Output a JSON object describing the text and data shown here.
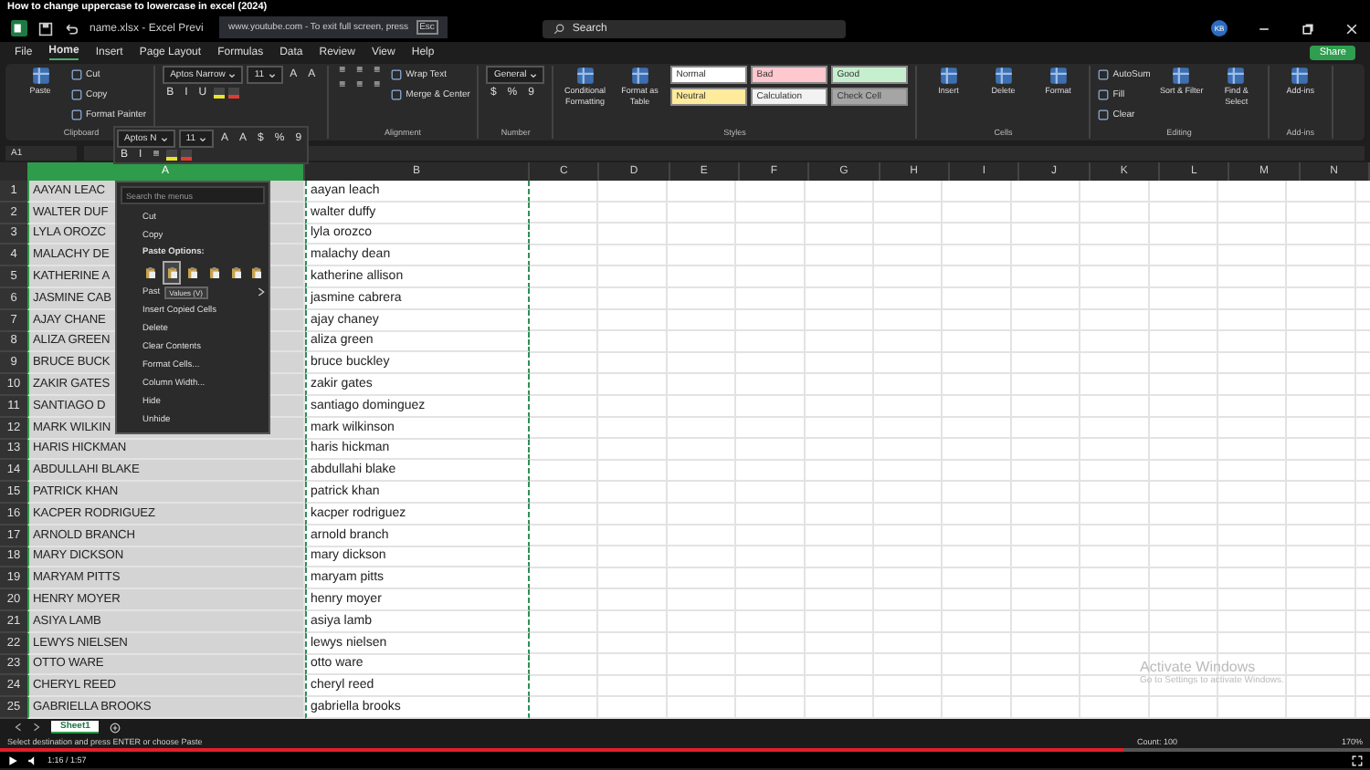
{
  "video_title": "How to change uppercase to lowercase in excel (2024)",
  "window": {
    "file": "name.xlsx - Excel Previ",
    "fullscreen_notice": "www.youtube.com - To exit full screen, press",
    "fullscreen_key": "Esc",
    "search_placeholder": "Search",
    "avatar": "KB"
  },
  "menu_tabs": [
    {
      "label": "File",
      "selected": false
    },
    {
      "label": "Home",
      "selected": true
    },
    {
      "label": "Insert",
      "selected": false
    },
    {
      "label": "Page Layout",
      "selected": false
    },
    {
      "label": "Formulas",
      "selected": false
    },
    {
      "label": "Data",
      "selected": false
    },
    {
      "label": "Review",
      "selected": false
    },
    {
      "label": "View",
      "selected": false
    },
    {
      "label": "Help",
      "selected": false
    }
  ],
  "share": "Share",
  "ribbon": [
    {
      "label": "Clipboard",
      "columns": [
        [
          [
            {
              "kind": "large",
              "label": "Paste"
            }
          ]
        ],
        [
          [
            {
              "kind": "small",
              "label": "Cut"
            }
          ],
          [
            {
              "kind": "small",
              "label": "Copy"
            }
          ],
          [
            {
              "kind": "small",
              "label": "Format Painter"
            }
          ]
        ]
      ]
    },
    {
      "columns": [
        [
          [
            {
              "kind": "field",
              "label": "Aptos Narrow"
            },
            {
              "kind": "field",
              "label": "11"
            },
            {
              "kind": "glyph",
              "label": "A"
            },
            {
              "kind": "glyph",
              "label": "A"
            }
          ],
          [
            {
              "kind": "glyph",
              "label": "B"
            },
            {
              "kind": "glyph",
              "label": "I"
            },
            {
              "kind": "glyph",
              "label": "U"
            },
            {
              "kind": "swatch",
              "color": "#e8e52a"
            },
            {
              "kind": "swatch",
              "color": "#e03c31"
            }
          ]
        ]
      ]
    },
    {
      "label": "Alignment",
      "columns": [
        [
          [
            {
              "kind": "glyph",
              "label": "≡"
            },
            {
              "kind": "glyph",
              "label": "≡"
            },
            {
              "kind": "glyph",
              "label": "≡"
            }
          ],
          [
            {
              "kind": "glyph",
              "label": "≡"
            },
            {
              "kind": "glyph",
              "label": "≡"
            },
            {
              "kind": "glyph",
              "label": "≡"
            }
          ]
        ],
        [
          [
            {
              "kind": "small",
              "label": "Wrap Text"
            }
          ],
          [
            {
              "kind": "small",
              "label": "Merge & Center"
            }
          ]
        ]
      ]
    },
    {
      "label": "Number",
      "columns": [
        [
          [
            {
              "kind": "field",
              "label": "General"
            }
          ],
          [
            {
              "kind": "glyph",
              "label": "$"
            },
            {
              "kind": "glyph",
              "label": "%"
            },
            {
              "kind": "glyph",
              "label": "9"
            }
          ]
        ]
      ]
    },
    {
      "label": "Styles",
      "columns": [
        [
          [
            {
              "kind": "large",
              "label": "Conditional Formatting"
            }
          ]
        ],
        [
          [
            {
              "kind": "large",
              "label": "Format as Table"
            }
          ]
        ],
        [
          [
            {
              "kind": "style",
              "label": "Normal",
              "color": "#ffffff"
            },
            {
              "kind": "style",
              "label": "Bad",
              "color": "#ffc7ce"
            },
            {
              "kind": "style",
              "label": "Good",
              "color": "#c6efce"
            }
          ],
          [
            {
              "kind": "style",
              "label": "Neutral",
              "color": "#ffeb9c"
            },
            {
              "kind": "style",
              "label": "Calculation",
              "color": "#f2f2f2"
            },
            {
              "kind": "style",
              "label": "Check Cell",
              "color": "#a5a5a5"
            }
          ]
        ]
      ]
    },
    {
      "label": "Cells",
      "columns": [
        [
          [
            {
              "kind": "large",
              "label": "Insert"
            }
          ]
        ],
        [
          [
            {
              "kind": "large",
              "label": "Delete"
            }
          ]
        ],
        [
          [
            {
              "kind": "large",
              "label": "Format"
            }
          ]
        ]
      ]
    },
    {
      "label": "Editing",
      "columns": [
        [
          [
            {
              "kind": "small",
              "label": "AutoSum"
            }
          ],
          [
            {
              "kind": "small",
              "label": "Fill"
            }
          ],
          [
            {
              "kind": "small",
              "label": "Clear"
            }
          ]
        ],
        [
          [
            {
              "kind": "large",
              "label": "Sort & Filter"
            }
          ]
        ],
        [
          [
            {
              "kind": "large",
              "label": "Find & Select"
            }
          ]
        ]
      ]
    },
    {
      "label": "Add-ins",
      "columns": [
        [
          [
            {
              "kind": "large",
              "label": "Add-ins"
            }
          ]
        ]
      ]
    }
  ],
  "name_box": "A1",
  "mini_toolbar": [
    [
      {
        "kind": "field",
        "label": "Aptos N"
      },
      {
        "kind": "field",
        "label": "11"
      },
      {
        "kind": "glyph",
        "label": "A"
      },
      {
        "kind": "glyph",
        "label": "A"
      },
      {
        "kind": "glyph",
        "label": "$"
      },
      {
        "kind": "glyph",
        "label": "%"
      },
      {
        "kind": "glyph",
        "label": "9"
      }
    ],
    [
      {
        "kind": "glyph",
        "label": "B"
      },
      {
        "kind": "glyph",
        "label": "I"
      },
      {
        "kind": "glyph",
        "label": "≡"
      },
      {
        "kind": "swatch",
        "color": "#e8e52a"
      },
      {
        "kind": "swatch",
        "color": "#e03c31"
      }
    ]
  ],
  "columns": [
    {
      "label": "A",
      "selected": true
    },
    {
      "label": "B",
      "selected": false
    },
    {
      "label": "C",
      "selected": false
    },
    {
      "label": "D",
      "selected": false
    },
    {
      "label": "E",
      "selected": false
    },
    {
      "label": "F",
      "selected": false
    },
    {
      "label": "G",
      "selected": false
    },
    {
      "label": "H",
      "selected": false
    },
    {
      "label": "I",
      "selected": false
    },
    {
      "label": "J",
      "selected": false
    },
    {
      "label": "K",
      "selected": false
    },
    {
      "label": "L",
      "selected": false
    },
    {
      "label": "M",
      "selected": false
    },
    {
      "label": "N",
      "selected": false
    }
  ],
  "rows": [
    {
      "number": "1",
      "cells": [
        "AAYAN LEAC",
        "aayan leach"
      ]
    },
    {
      "number": "2",
      "cells": [
        "WALTER DUF",
        "walter duffy"
      ]
    },
    {
      "number": "3",
      "cells": [
        "LYLA OROZC",
        "lyla orozco"
      ]
    },
    {
      "number": "4",
      "cells": [
        "MALACHY DE",
        "malachy dean"
      ]
    },
    {
      "number": "5",
      "cells": [
        "KATHERINE A",
        "katherine allison"
      ]
    },
    {
      "number": "6",
      "cells": [
        "JASMINE CAB",
        "jasmine cabrera"
      ]
    },
    {
      "number": "7",
      "cells": [
        "AJAY CHANE",
        "ajay chaney"
      ]
    },
    {
      "number": "8",
      "cells": [
        "ALIZA GREEN",
        "aliza green"
      ]
    },
    {
      "number": "9",
      "cells": [
        "BRUCE BUCK",
        "bruce buckley"
      ]
    },
    {
      "number": "10",
      "cells": [
        "ZAKIR GATES",
        "zakir gates"
      ]
    },
    {
      "number": "11",
      "cells": [
        "SANTIAGO D",
        "santiago dominguez"
      ]
    },
    {
      "number": "12",
      "cells": [
        "MARK WILKIN",
        "mark wilkinson"
      ]
    },
    {
      "number": "13",
      "cells": [
        "HARIS HICKMAN",
        "haris hickman"
      ]
    },
    {
      "number": "14",
      "cells": [
        "ABDULLAHI BLAKE",
        "abdullahi blake"
      ]
    },
    {
      "number": "15",
      "cells": [
        "PATRICK KHAN",
        "patrick khan"
      ]
    },
    {
      "number": "16",
      "cells": [
        "KACPER RODRIGUEZ",
        "kacper rodriguez"
      ]
    },
    {
      "number": "17",
      "cells": [
        "ARNOLD BRANCH",
        "arnold branch"
      ]
    },
    {
      "number": "18",
      "cells": [
        "MARY DICKSON",
        "mary dickson"
      ]
    },
    {
      "number": "19",
      "cells": [
        "MARYAM PITTS",
        "maryam pitts"
      ]
    },
    {
      "number": "20",
      "cells": [
        "HENRY MOYER",
        "henry moyer"
      ]
    },
    {
      "number": "21",
      "cells": [
        "ASIYA LAMB",
        "asiya lamb"
      ]
    },
    {
      "number": "22",
      "cells": [
        "LEWYS NIELSEN",
        "lewys nielsen"
      ]
    },
    {
      "number": "23",
      "cells": [
        "OTTO WARE",
        "otto ware"
      ]
    },
    {
      "number": "24",
      "cells": [
        "CHERYL REED",
        "cheryl reed"
      ]
    },
    {
      "number": "25",
      "cells": [
        "GABRIELLA BROOKS",
        "gabriella brooks"
      ]
    }
  ],
  "context_menu": [
    {
      "kind": "search",
      "placeholder": "Search the menus"
    },
    {
      "kind": "item",
      "label": "Cut"
    },
    {
      "kind": "item",
      "label": "Copy"
    },
    {
      "kind": "header",
      "label": "Paste Options:"
    },
    {
      "kind": "paste",
      "buttons": [
        {
          "selected": false
        },
        {
          "selected": true
        },
        {
          "selected": false
        },
        {
          "selected": false
        },
        {
          "selected": false
        },
        {
          "selected": false
        }
      ]
    },
    {
      "kind": "item",
      "label": "Past",
      "submenu": true,
      "tooltip": "Values (V)"
    },
    {
      "kind": "item",
      "label": "Insert Copied Cells"
    },
    {
      "kind": "item",
      "label": "Delete"
    },
    {
      "kind": "item",
      "label": "Clear Contents"
    },
    {
      "kind": "item",
      "label": "Format Cells..."
    },
    {
      "kind": "item",
      "label": "Column Width..."
    },
    {
      "kind": "item",
      "label": "Hide"
    },
    {
      "kind": "item",
      "label": "Unhide"
    }
  ],
  "activation": {
    "title": "Activate Windows",
    "subtitle": "Go to Settings to activate Windows."
  },
  "sheets": [
    {
      "label": "Sheet1",
      "selected": true
    }
  ],
  "status_bar": {
    "message": "Select destination and press ENTER or choose Paste",
    "count": "Count: 100",
    "zoom": "170%"
  },
  "player": {
    "time": "1:16 / 1:57",
    "level": 0.82
  }
}
